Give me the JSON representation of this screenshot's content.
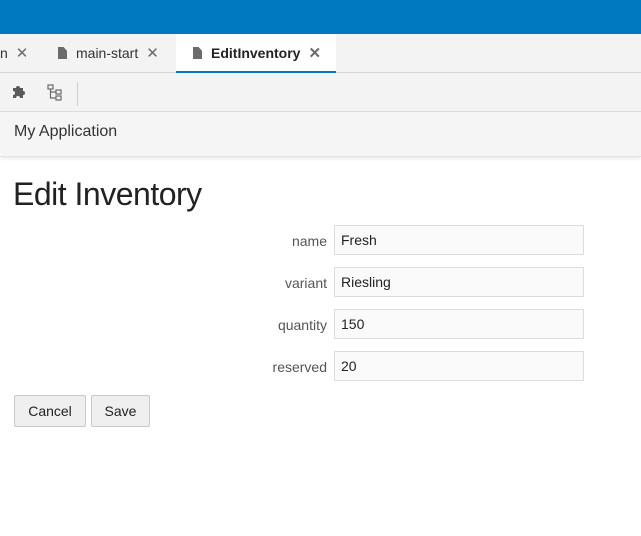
{
  "tabs": [
    {
      "label": "n",
      "active": false
    },
    {
      "label": "main-start",
      "active": false
    },
    {
      "label": "EditInventory",
      "active": true
    }
  ],
  "toolbar": {
    "icons": [
      "puzzle-icon",
      "tree-icon"
    ]
  },
  "app": {
    "title": "My Application"
  },
  "page": {
    "title": "Edit Inventory"
  },
  "form": {
    "fields": [
      {
        "label": "name",
        "value": "Fresh"
      },
      {
        "label": "variant",
        "value": "Riesling"
      },
      {
        "label": "quantity",
        "value": "150"
      },
      {
        "label": "reserved",
        "value": "20"
      }
    ],
    "cancel_label": "Cancel",
    "save_label": "Save"
  },
  "colors": {
    "accent": "#0079c1",
    "button": "#efefef",
    "field": "#fafafa"
  }
}
